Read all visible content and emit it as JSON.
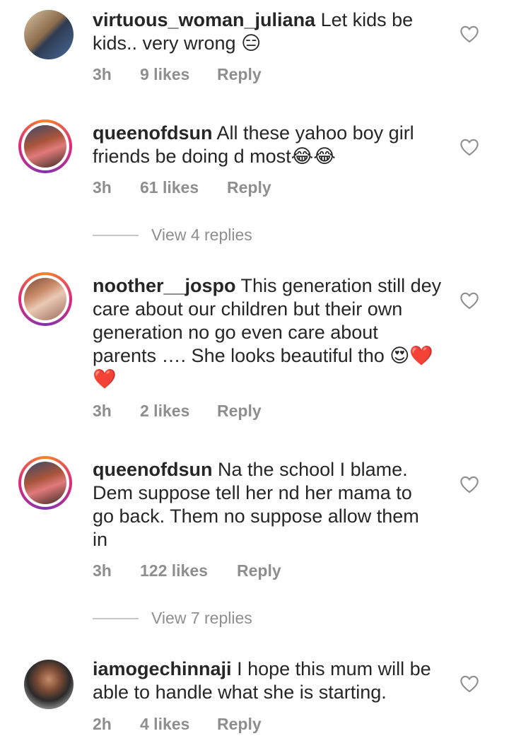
{
  "comments": [
    {
      "username": "virtuous_woman_juliana",
      "text": "Let kids be kids.. very wrong",
      "emoji": "😑",
      "time": "3h",
      "likes": "9 likes",
      "reply": "Reply"
    },
    {
      "username": "queenofdsun",
      "text": "All these yahoo boy girl friends be doing d most",
      "emoji": "😂😂",
      "time": "3h",
      "likes": "61 likes",
      "reply": "Reply"
    },
    {
      "username": "noother__jospo",
      "text": "This generation still dey care about our children but their own generation no go even care about parents …. She looks beautiful tho",
      "emoji": "😍❤️❤️",
      "time": "3h",
      "likes": "2 likes",
      "reply": "Reply"
    },
    {
      "username": "queenofdsun",
      "text": "Na the school I blame. Dem suppose tell her nd her mama to go back. Them no suppose allow them in",
      "time": "3h",
      "likes": "122 likes",
      "reply": "Reply"
    },
    {
      "username": "iamogechinnaji",
      "text": "I hope this mum will be able to handle what she is starting.",
      "time": "2h",
      "likes": "4 likes",
      "reply": "Reply"
    }
  ],
  "view_replies": [
    "View 4 replies",
    "View 7 replies"
  ],
  "colors": {
    "meta": "#8e8e8e",
    "text": "#262626",
    "story_ring": "#dd2a7b"
  }
}
